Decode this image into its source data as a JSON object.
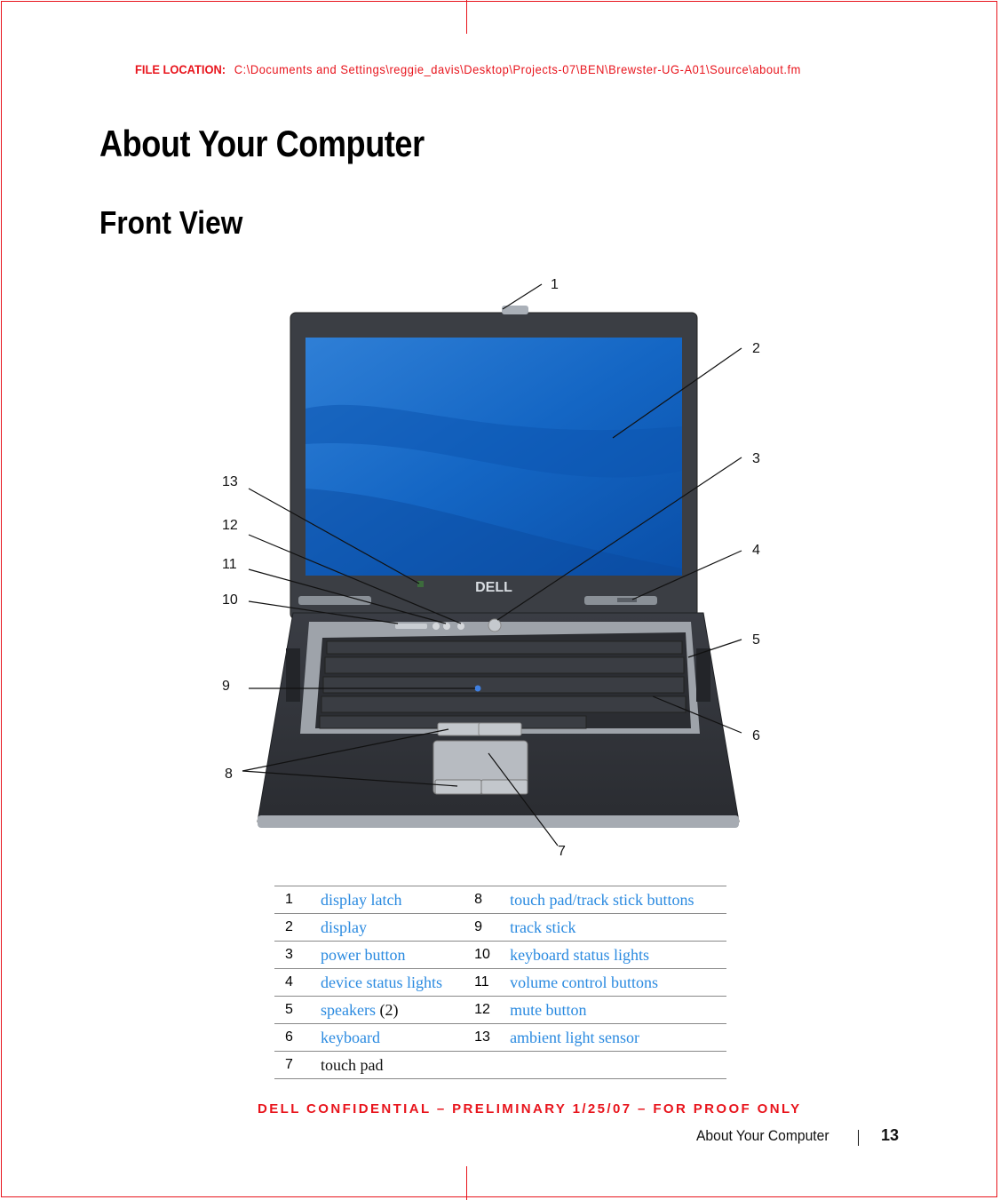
{
  "header": {
    "file_location_label": "FILE LOCATION:",
    "file_location_path": "C:\\Documents and Settings\\reggie_davis\\Desktop\\Projects-07\\BEN\\Brewster-UG-A01\\Source\\about.fm"
  },
  "chapter_title": "About Your Computer",
  "section_title": "Front View",
  "figure": {
    "description": "Laptop front view with numbered callouts",
    "brand_logo": "DELL",
    "callouts": [
      "1",
      "2",
      "3",
      "4",
      "5",
      "6",
      "7",
      "8",
      "9",
      "10",
      "11",
      "12",
      "13"
    ]
  },
  "legend": {
    "rows": [
      {
        "left_num": "1",
        "left_label": "display latch",
        "right_num": "8",
        "right_label": "touch pad/track stick buttons"
      },
      {
        "left_num": "2",
        "left_label": "display",
        "right_num": "9",
        "right_label": "track stick"
      },
      {
        "left_num": "3",
        "left_label": "power button",
        "right_num": "10",
        "right_label": "keyboard status lights"
      },
      {
        "left_num": "4",
        "left_label": "device status lights",
        "right_num": "11",
        "right_label": "volume control buttons"
      },
      {
        "left_num": "5",
        "left_label": "speakers",
        "left_suffix": "(2)",
        "right_num": "12",
        "right_label": "mute button"
      },
      {
        "left_num": "6",
        "left_label": "keyboard",
        "right_num": "13",
        "right_label": "ambient light sensor"
      },
      {
        "left_num": "7",
        "left_label": "touch pad",
        "right_num": "",
        "right_label": ""
      }
    ]
  },
  "footer": {
    "confidential": "DELL CONFIDENTIAL – PRELIMINARY 1/25/07 – FOR PROOF ONLY",
    "running_title": "About Your Computer",
    "page_number": "13"
  },
  "colors": {
    "proof_red": "#e8141c",
    "link_blue": "#2a8ae0"
  }
}
